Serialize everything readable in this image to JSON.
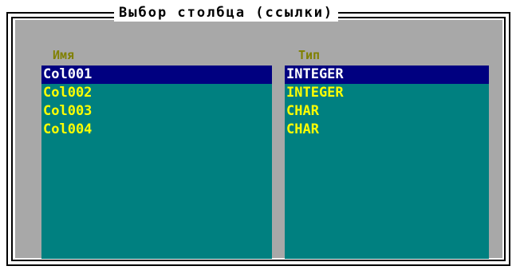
{
  "dialog": {
    "title": "Выбор столбца (ссылки)"
  },
  "columns": {
    "name_header": "Имя",
    "type_header": "Тип"
  },
  "rows": [
    {
      "name": "Col001",
      "type": "INTEGER",
      "selected": true
    },
    {
      "name": "Col002",
      "type": "INTEGER",
      "selected": false
    },
    {
      "name": "Col003",
      "type": "CHAR",
      "selected": false
    },
    {
      "name": "Col004",
      "type": "CHAR",
      "selected": false
    }
  ],
  "colors": {
    "panel": "#a8a8a8",
    "list_background": "#008080",
    "selection_background": "#000080",
    "item_text": "#ffff00",
    "selected_text": "#ffffff",
    "header_text": "#808000"
  }
}
